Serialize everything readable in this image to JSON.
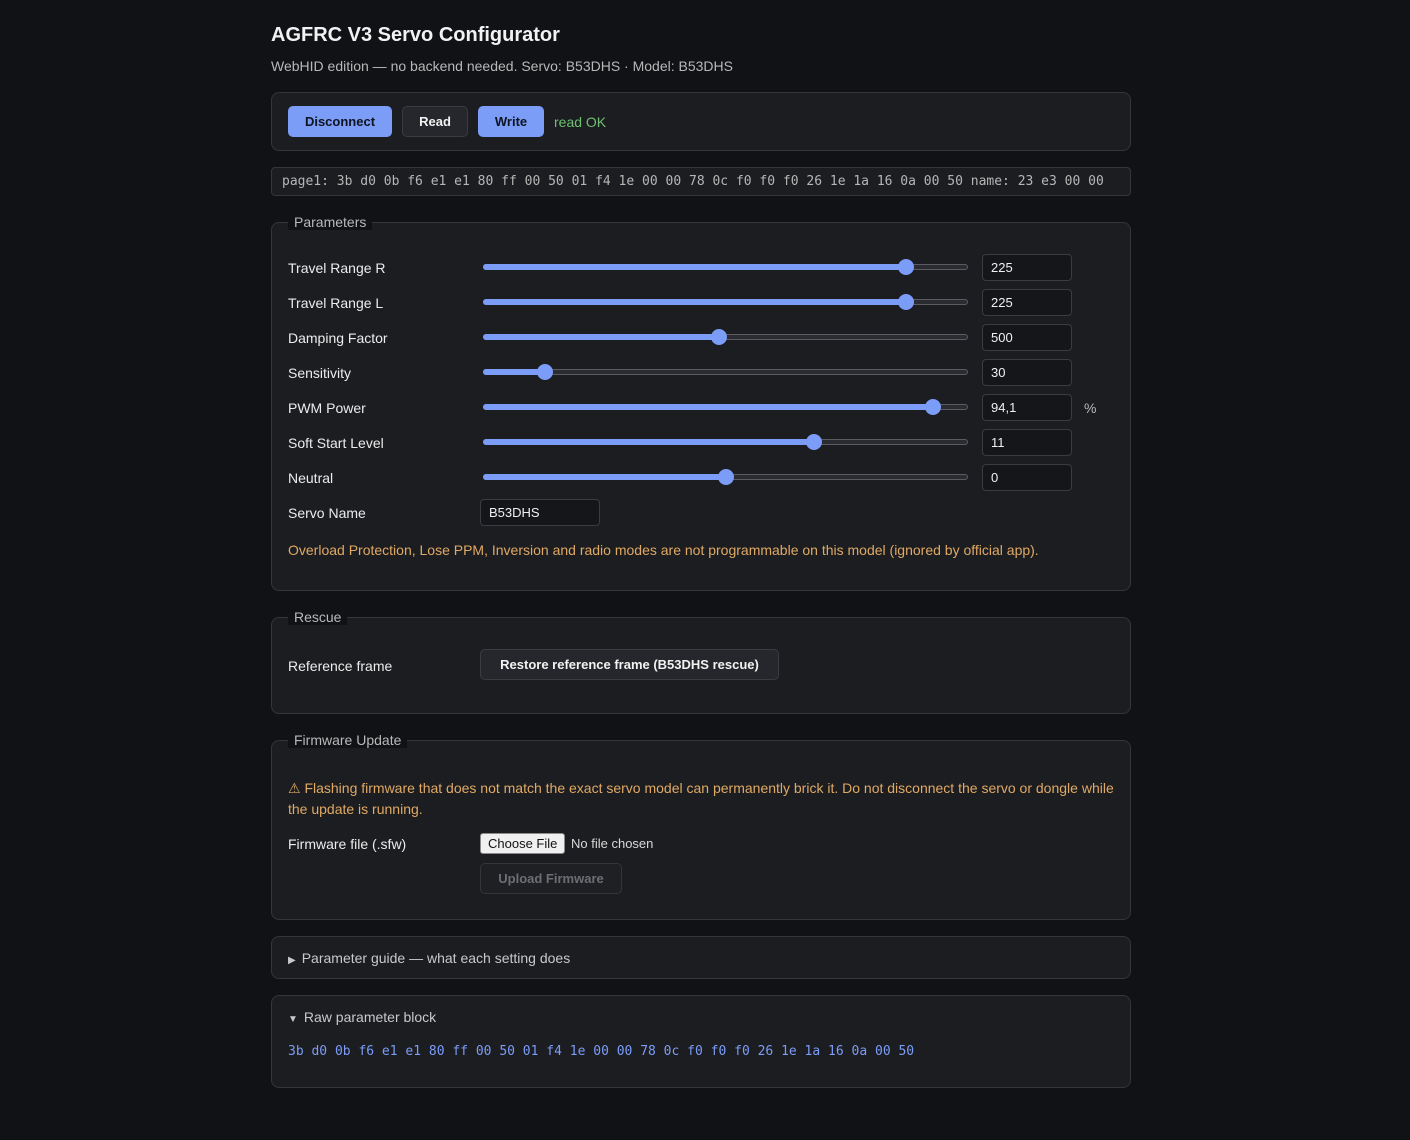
{
  "header": {
    "title": "AGFRC V3 Servo Configurator",
    "subtitle": "WebHID edition — no backend needed. Servo: B53DHS · Model: B53DHS"
  },
  "toolbar": {
    "disconnect_label": "Disconnect",
    "read_label": "Read",
    "write_label": "Write",
    "status": "read OK",
    "status_color": "#6fbf73"
  },
  "hex_line": "page1: 3b d0 0b f6 e1 e1 80 ff 00 50 01 f4 1e 00 00 78 0c f0 f0 f0 26 1e 1a 16 0a 00 50 name: 23 e3 00 00",
  "parameters": {
    "legend": "Parameters",
    "sliders": [
      {
        "label": "Travel Range R",
        "value": "225",
        "fraction": 0.872
      },
      {
        "label": "Travel Range L",
        "value": "225",
        "fraction": 0.872
      },
      {
        "label": "Damping Factor",
        "value": "500",
        "fraction": 0.487
      },
      {
        "label": "Sensitivity",
        "value": "30",
        "fraction": 0.128
      },
      {
        "label": "PWM Power",
        "value": "94,1",
        "unit": "%",
        "fraction": 0.928
      },
      {
        "label": "Soft Start Level",
        "value": "11",
        "fraction": 0.682
      },
      {
        "label": "Neutral",
        "value": "0",
        "fraction": 0.502
      }
    ],
    "servo_name_label": "Servo Name",
    "servo_name_value": "B53DHS",
    "note": "Overload Protection, Lose PPM, Inversion and radio modes are not programmable on this model (ignored by official app)."
  },
  "rescue": {
    "legend": "Rescue",
    "label": "Reference frame",
    "button_label": "Restore reference frame (B53DHS rescue)"
  },
  "firmware": {
    "legend": "Firmware Update",
    "warning": "⚠ Flashing firmware that does not match the exact servo model can permanently brick it. Do not disconnect the servo or dongle while the update is running.",
    "file_label": "Firmware file (.sfw)",
    "choose_file_label": "Choose File",
    "no_file_text": "No file chosen",
    "upload_label": "Upload Firmware"
  },
  "guide": {
    "summary": "Parameter guide — what each setting does",
    "icon": "triangle-right-icon"
  },
  "raw": {
    "summary": "Raw parameter block",
    "icon": "triangle-down-icon",
    "hex": "3b d0 0b f6 e1 e1 80 ff 00 50 01 f4 1e 00 00 78 0c f0 f0 f0 26 1e 1a 16 0a 00 50"
  },
  "colors": {
    "accent": "#7b9cf7",
    "warning": "#e0a964",
    "background": "#111216",
    "panel": "#1c1d21"
  }
}
